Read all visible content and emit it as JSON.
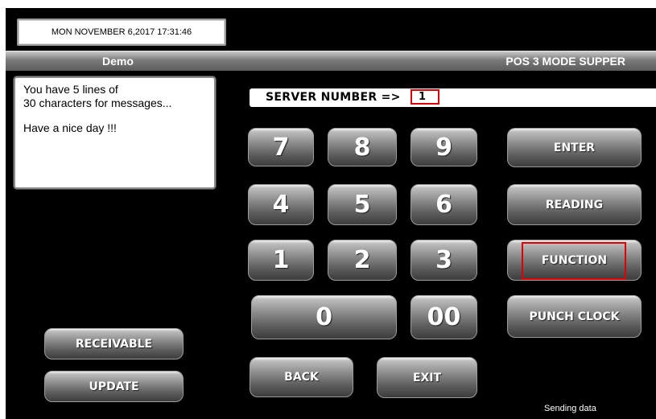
{
  "datetime": "MON NOVEMBER  6,2017  17:31:46",
  "header": {
    "left": "Demo",
    "right": "POS 3  MODE SUPPER"
  },
  "messages": {
    "line1": "You have 5 lines of",
    "line2": "30 characters for messages...",
    "line3": "Have a nice day !!!"
  },
  "server": {
    "label": "SERVER NUMBER  =>",
    "value": "1"
  },
  "keypad": {
    "k7": "7",
    "k8": "8",
    "k9": "9",
    "k4": "4",
    "k5": "5",
    "k6": "6",
    "k1": "1",
    "k2": "2",
    "k3": "3",
    "k0": "0",
    "k00": "00"
  },
  "buttons": {
    "enter": "ENTER",
    "reading": "READING",
    "function": "FUNCTION",
    "punch_clock": "PUNCH CLOCK",
    "back": "BACK",
    "exit": "EXIT",
    "receivable": "RECEIVABLE",
    "update": "UPDATE"
  },
  "status": "Sending data"
}
